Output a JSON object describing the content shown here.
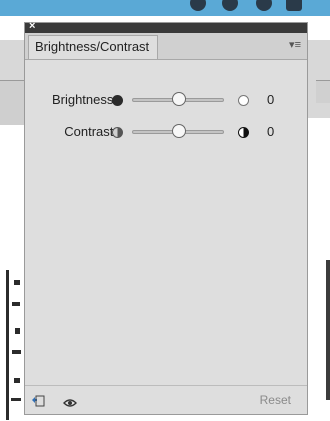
{
  "panel": {
    "close_glyph": "×",
    "title": "Brightness/Contrast",
    "menu_glyph": "▾≡"
  },
  "brightness": {
    "label": "Brightness:",
    "value": "0",
    "level": 0.5
  },
  "contrast": {
    "label": "Contrast:",
    "value": "0",
    "level": 0.5
  },
  "footer": {
    "reset_label": "Reset"
  },
  "icons": {
    "close": "close-icon",
    "menu": "panel-menu-icon",
    "brightness_left": "dark-circle-icon",
    "brightness_right": "light-circle-icon",
    "contrast_left": "low-contrast-icon",
    "contrast_right": "high-contrast-icon",
    "clip": "clip-to-layer-icon",
    "visibility": "eye-icon"
  },
  "colors": {
    "panel_bg": "#dedede",
    "header_bg": "#3a3a3a",
    "app_topbar": "#5aa9d6"
  }
}
